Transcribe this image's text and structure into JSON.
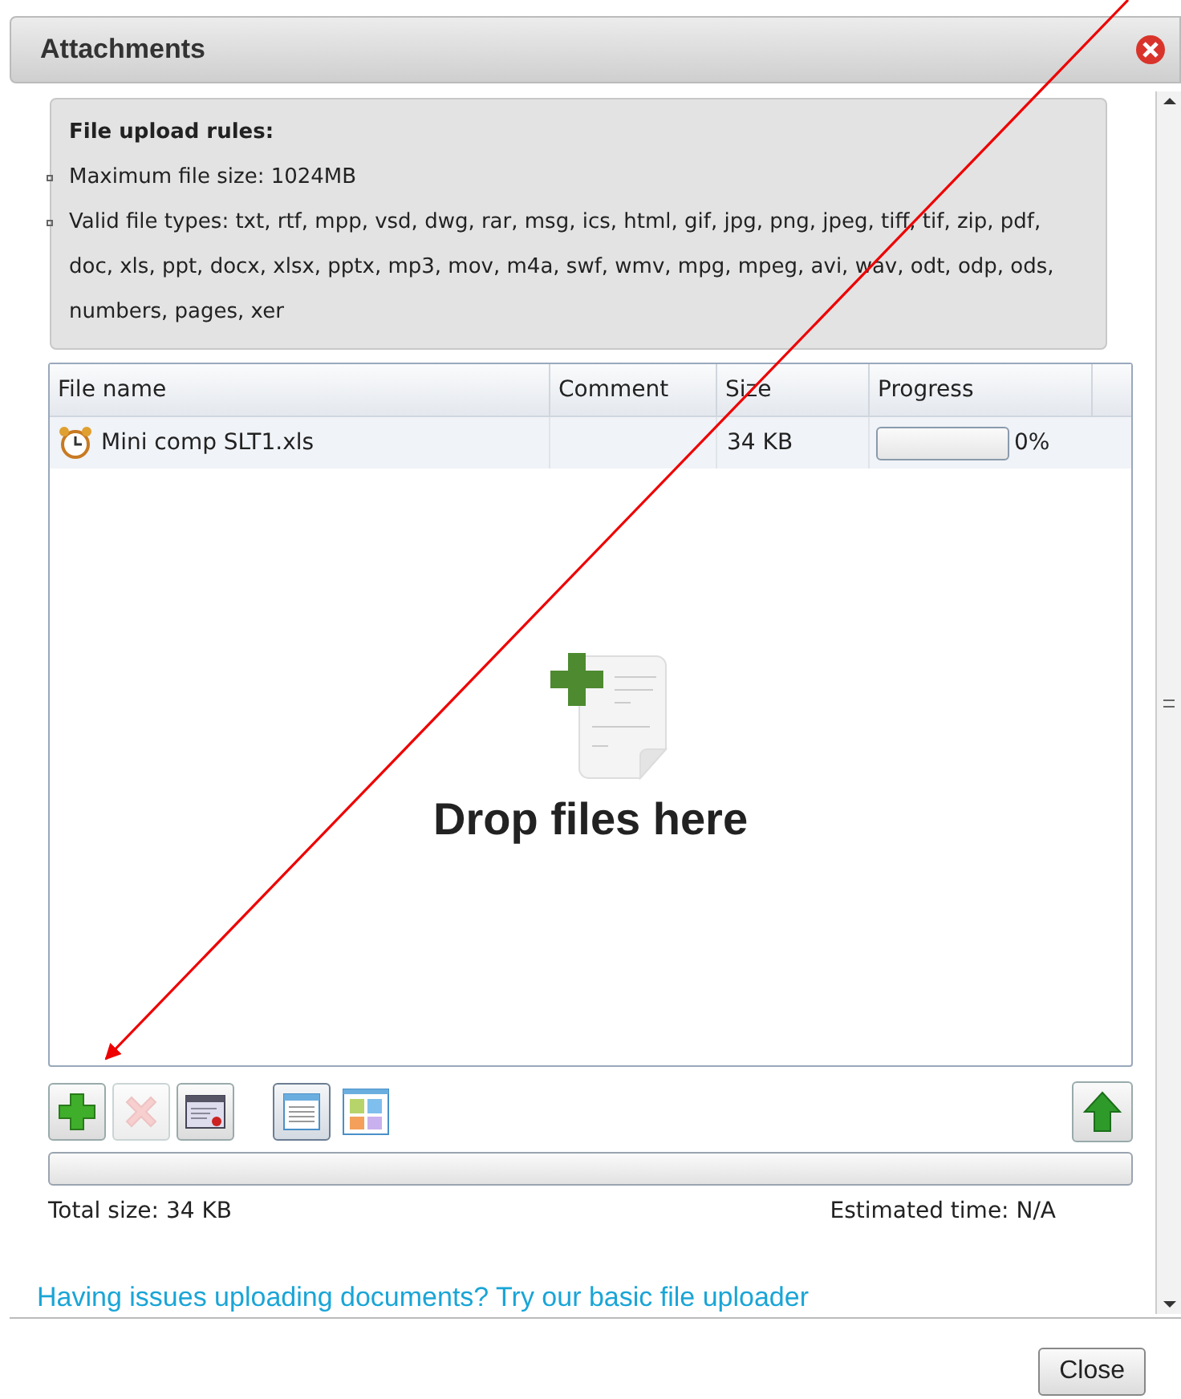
{
  "dialog": {
    "title": "Attachments"
  },
  "rules": {
    "title": "File upload rules:",
    "items": [
      "Maximum file size: 1024MB",
      "Valid file types: txt, rtf, mpp, vsd, dwg, rar, msg, ics, html, gif, jpg, png, jpeg, tiff, tif, zip, pdf, doc, xls, ppt, docx, xlsx, pptx, mp3, mov, m4a, swf, wmv, mpg, mpeg, avi, wav, odt, odp, ods, numbers, pages, xer"
    ]
  },
  "table": {
    "columns": [
      "File name",
      "Comment",
      "Size",
      "Progress"
    ],
    "rows": [
      {
        "file_name": "Mini comp SLT1.xls",
        "comment": "",
        "size": "34 KB",
        "level": 0,
        "percent": "0%"
      }
    ]
  },
  "drop_zone": {
    "label": "Drop files here"
  },
  "toolbar": [
    {
      "kind": "add",
      "disabled": false
    },
    {
      "kind": "remove",
      "disabled": true
    },
    {
      "kind": "clear",
      "disabled": false
    },
    {
      "kind": "list-view",
      "selected": true
    },
    {
      "kind": "grid-view",
      "selected": false
    }
  ],
  "upload_button": {
    "disabled": false
  },
  "total_progress": {
    "level": 0
  },
  "total_size": "Total size: 34 KB",
  "estimated_time": "Estimated time: N/A",
  "basic_uploader_link": "Having issues uploading documents? Try our basic file uploader",
  "close_button": "Close"
}
